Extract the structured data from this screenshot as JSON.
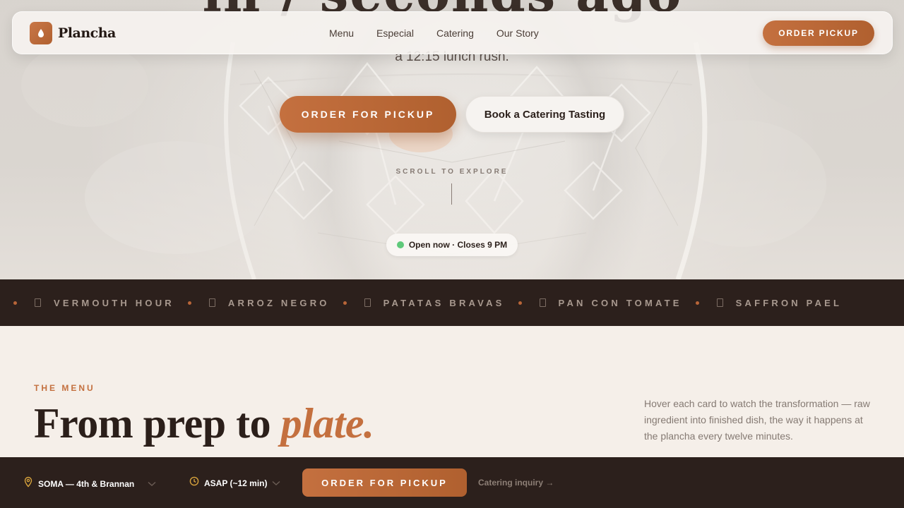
{
  "colors": {
    "accent": "#c4703f",
    "dark": "#2c201c",
    "cream": "#f5efe9",
    "open_status": "#5fc97a"
  },
  "nav": {
    "brand": "Plancha",
    "links": [
      "Menu",
      "Especial",
      "Catering",
      "Our Story"
    ],
    "cta": "ORDER PICKUP"
  },
  "hero": {
    "headline_partial": "in / seconds agoʼ",
    "subtitle": "a 12:15 lunch rush.",
    "primary_cta": "ORDER FOR PICKUP",
    "secondary_cta": "Book a Catering Tasting",
    "scroll_hint": "SCROLL TO EXPLORE",
    "status": "Open now · Closes 9 PM"
  },
  "marquee": {
    "items": [
      "VERMOUTH HOUR",
      "ARROZ NEGRO",
      "PATATAS BRAVAS",
      "PAN CON TOMATE",
      "SAFFRON PAEL"
    ]
  },
  "menu_section": {
    "eyebrow": "THE MENU",
    "title_main": "From prep to ",
    "title_accent": "plate.",
    "description": "Hover each card to watch the transformation — raw ingredient into finished dish, the way it happens at the plancha every twelve minutes."
  },
  "order_bar": {
    "location": "SOMA — 4th & Brannan",
    "time": "ASAP (~12 min)",
    "cta": "ORDER FOR PICKUP",
    "catering_link": "Catering inquiry →"
  },
  "icons": {
    "brand_mark": "flame-icon",
    "location": "map-pin-icon",
    "time": "clock-icon",
    "dropdown": "chevron-down-icon",
    "marquee_item": "square-icon"
  }
}
